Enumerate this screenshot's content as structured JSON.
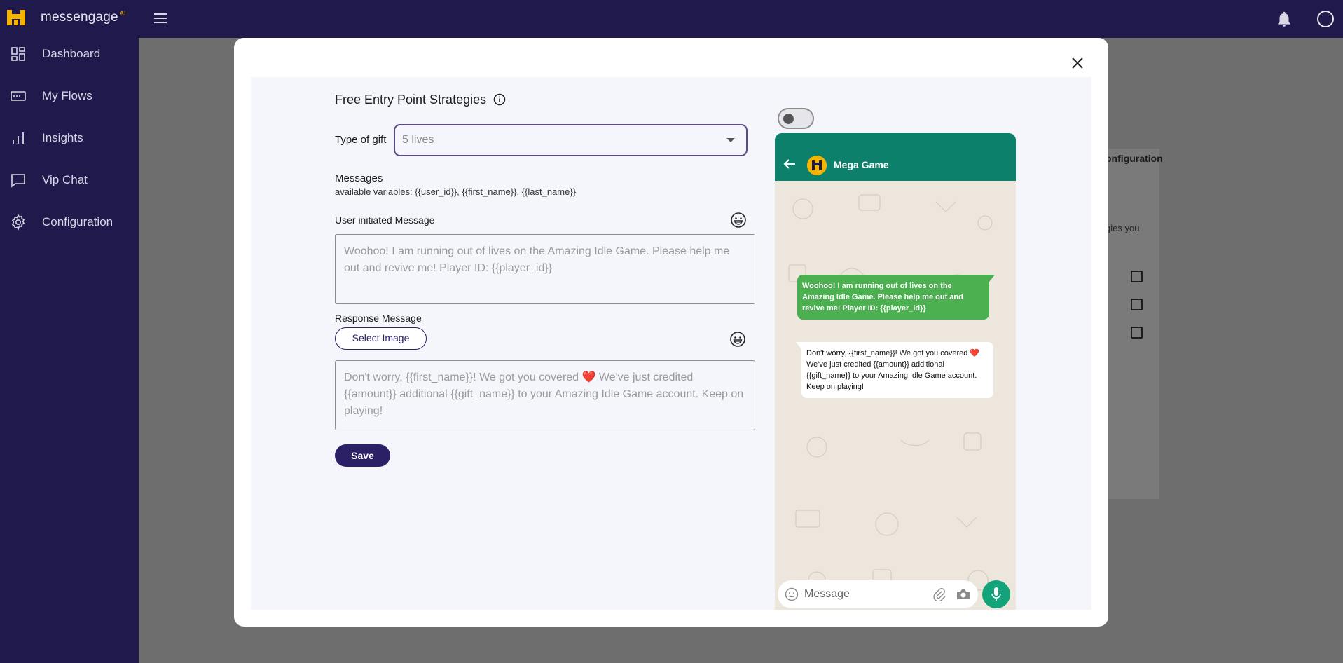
{
  "app": {
    "brand": "messengage",
    "brand_suffix": "AI"
  },
  "sidebar": {
    "items": [
      {
        "label": "Dashboard",
        "icon": "dashboard-icon"
      },
      {
        "label": "My Flows",
        "icon": "flows-icon"
      },
      {
        "label": "Insights",
        "icon": "insights-icon"
      },
      {
        "label": "Vip Chat",
        "icon": "chat-icon"
      },
      {
        "label": "Configuration",
        "icon": "gear-icon"
      }
    ]
  },
  "background": {
    "config_text": "onfiguration",
    "partial_text": "gies you"
  },
  "modal": {
    "title": "Free Entry Point Strategies",
    "type_of_gift_label": "Type of gift",
    "type_of_gift_value": "5 lives",
    "messages_label": "Messages",
    "variables_text": "available variables: {{user_id}}, {{first_name}}, {{last_name}}",
    "user_initiated_label": "User initiated Message",
    "user_initiated_text": "Woohoo! I am running out of lives on the Amazing Idle Game. Please help me out and revive me! Player ID: {{player_id}}",
    "response_label": "Response Message",
    "select_image_label": "Select Image",
    "response_text": "Don't worry, {{first_name}}! We got you covered ❤️ We've just credited {{amount}} additional {{gift_name}} to your Amazing Idle Game account. Keep on playing!",
    "save_label": "Save",
    "toggle_on": false
  },
  "preview": {
    "contact_name": "Mega Game",
    "outgoing_message": "Woohoo! I am running out of lives on the Amazing Idle Game. Please help me out and revive me! Player ID: {{player_id}}",
    "incoming_message": "Don't worry, {{first_name}}! We got you covered ❤️ We've just credited {{amount}} additional {{gift_name}} to your Amazing Idle Game account. Keep on playing!",
    "input_placeholder": "Message"
  },
  "colors": {
    "sidebar_bg": "#1f1a4b",
    "accent": "#2b1f66",
    "whatsapp_header": "#0c806b",
    "outgoing_bubble": "#4caf50",
    "mic_button": "#12a37b"
  }
}
